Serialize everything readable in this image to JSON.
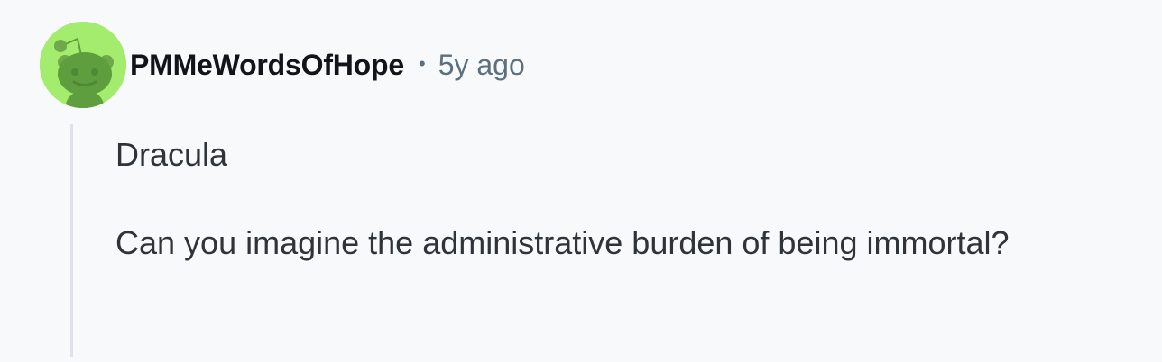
{
  "comment": {
    "author": "PMMeWordsOfHope",
    "separator": "•",
    "timestamp": "5y ago",
    "avatar_icon": "reddit-snoo-avatar-icon",
    "paragraphs": [
      "Dracula",
      "Can you imagine the administrative burden of being immortal?"
    ]
  },
  "colors": {
    "avatar_background": "#a3ec6e",
    "avatar_figure": "#5e9e3f",
    "username": "#111418",
    "timestamp": "#5c6f7e",
    "thread_line": "#dde3e8",
    "page_background": "#f7f9fb"
  }
}
